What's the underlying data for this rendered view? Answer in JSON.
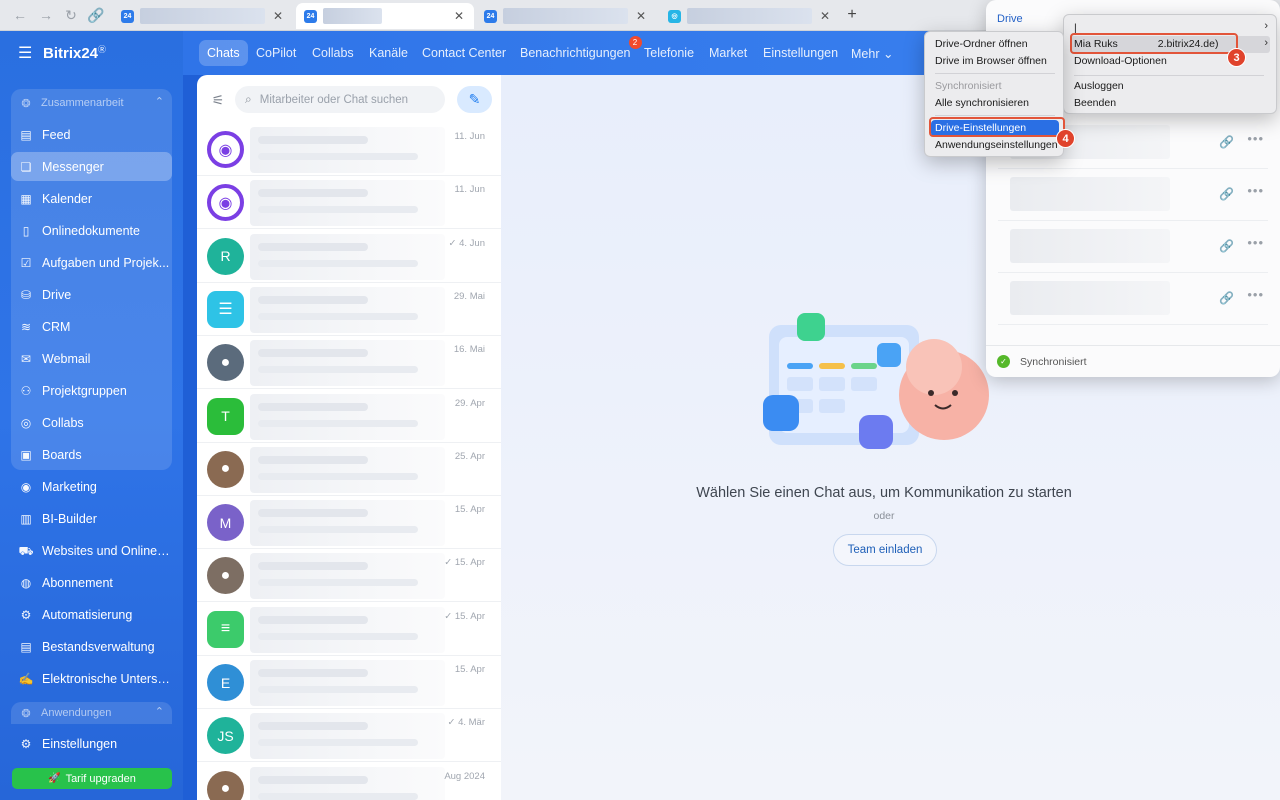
{
  "browser": {
    "tabs": [
      {
        "favicon": "24",
        "active": false
      },
      {
        "favicon": "24",
        "active": true
      },
      {
        "favicon": "24",
        "active": false
      },
      {
        "favicon": "drive",
        "active": false
      }
    ],
    "new_tab": "+"
  },
  "sidebar": {
    "logo": "Bitrix24",
    "logo_mark": "Ⓡ",
    "group_label": "Zusammenarbeit",
    "items": [
      {
        "label": "Feed",
        "icon": "feed-icon",
        "active": false
      },
      {
        "label": "Messenger",
        "icon": "chat-icon",
        "active": true
      },
      {
        "label": "Kalender",
        "icon": "calendar-icon",
        "active": false
      },
      {
        "label": "Onlinedokumente",
        "icon": "document-icon",
        "active": false
      },
      {
        "label": "Aufgaben und Projek...",
        "icon": "tasks-icon",
        "active": false
      },
      {
        "label": "Drive",
        "icon": "drive-icon",
        "active": false
      },
      {
        "label": "CRM",
        "icon": "crm-icon",
        "active": false
      },
      {
        "label": "Webmail",
        "icon": "mail-icon",
        "active": false
      },
      {
        "label": "Projektgruppen",
        "icon": "groups-icon",
        "active": false
      },
      {
        "label": "Collabs",
        "icon": "collabs-icon",
        "active": false
      },
      {
        "label": "Boards",
        "icon": "boards-icon",
        "active": false
      },
      {
        "label": "Marketing",
        "icon": "marketing-icon",
        "active": false
      },
      {
        "label": "BI-Builder",
        "icon": "chart-icon",
        "active": false
      },
      {
        "label": "Websites und Onlines...",
        "icon": "cart-icon",
        "active": false
      },
      {
        "label": "Abonnement",
        "icon": "subscription-icon",
        "active": false
      },
      {
        "label": "Automatisierung",
        "icon": "robot-icon",
        "active": false
      },
      {
        "label": "Bestandsverwaltung",
        "icon": "inventory-icon",
        "active": false
      },
      {
        "label": "Elektronische Untersc...",
        "icon": "signature-icon",
        "active": false
      }
    ],
    "group2_label": "Anwendungen",
    "settings": "Einstellungen",
    "upgrade": "Tarif upgraden"
  },
  "topnav": {
    "items": [
      {
        "label": "Chats",
        "active": true
      },
      {
        "label": "CoPilot"
      },
      {
        "label": "Collabs"
      },
      {
        "label": "Kanäle"
      },
      {
        "label": "Contact Center"
      },
      {
        "label": "Benachrichtigungen",
        "badge": "2"
      },
      {
        "label": "Telefonie"
      },
      {
        "label": "Market"
      },
      {
        "label": "Einstellungen"
      },
      {
        "label": "Mehr ⌄"
      }
    ]
  },
  "chatlist": {
    "search_placeholder": "Mitarbeiter oder Chat suchen",
    "chats": [
      {
        "avatar": "",
        "color": "#7b3fe4",
        "kind": "copilot",
        "date": "11. Jun"
      },
      {
        "avatar": "",
        "color": "#7b3fe4",
        "kind": "copilot",
        "date": "11. Jun"
      },
      {
        "avatar": "R",
        "color": "#1fb39a",
        "kind": "letter",
        "date": "✓ 4. Jun"
      },
      {
        "avatar": "",
        "color": "#2ec3e6",
        "kind": "chat",
        "date": "29. Mai"
      },
      {
        "avatar": "",
        "color": "#5b6b7c",
        "kind": "photo",
        "date": "16. Mai"
      },
      {
        "avatar": "T",
        "color": "#2bbd3a",
        "kind": "hex",
        "date": "29. Apr"
      },
      {
        "avatar": "",
        "color": "#8a6a52",
        "kind": "photo",
        "date": "25. Apr"
      },
      {
        "avatar": "M",
        "color": "#7a62c9",
        "kind": "letter",
        "date": "15. Apr"
      },
      {
        "avatar": "",
        "color": "#7d6e63",
        "kind": "photo",
        "date": "✓ 15. Apr"
      },
      {
        "avatar": "",
        "color": "#3ccb6b",
        "kind": "doc",
        "date": "✓ 15. Apr"
      },
      {
        "avatar": "E",
        "color": "#2f8fd6",
        "kind": "letter",
        "date": "15. Apr"
      },
      {
        "avatar": "JS",
        "color": "#1fb39a",
        "kind": "letter",
        "date": "✓ 4. Mär"
      },
      {
        "avatar": "",
        "color": "#8a6a52",
        "kind": "photo",
        "date": "Aug 2024"
      }
    ]
  },
  "main": {
    "empty_title": "Wählen Sie einen Chat aus, um Kommunikation zu starten",
    "or": "oder",
    "invite": "Team einladen"
  },
  "drive": {
    "title": "Drive",
    "status": "Synchronisiert"
  },
  "menu_left": {
    "open_folder": "Drive-Ordner öffnen",
    "open_browser": "Drive im Browser öffnen",
    "sync_header": "Synchronisiert",
    "sync_all": "Alle synchronisieren",
    "drive_settings": "Drive-Einstellungen",
    "app_settings": "Anwendungseinstellungen"
  },
  "menu_right": {
    "account": "Mia Ruks",
    "account_domain": "2.bitrix24.de)",
    "download_options": "Download-Optionen",
    "logout": "Ausloggen",
    "quit": "Beenden"
  },
  "steps": {
    "account_step": "3",
    "settings_step": "4"
  }
}
